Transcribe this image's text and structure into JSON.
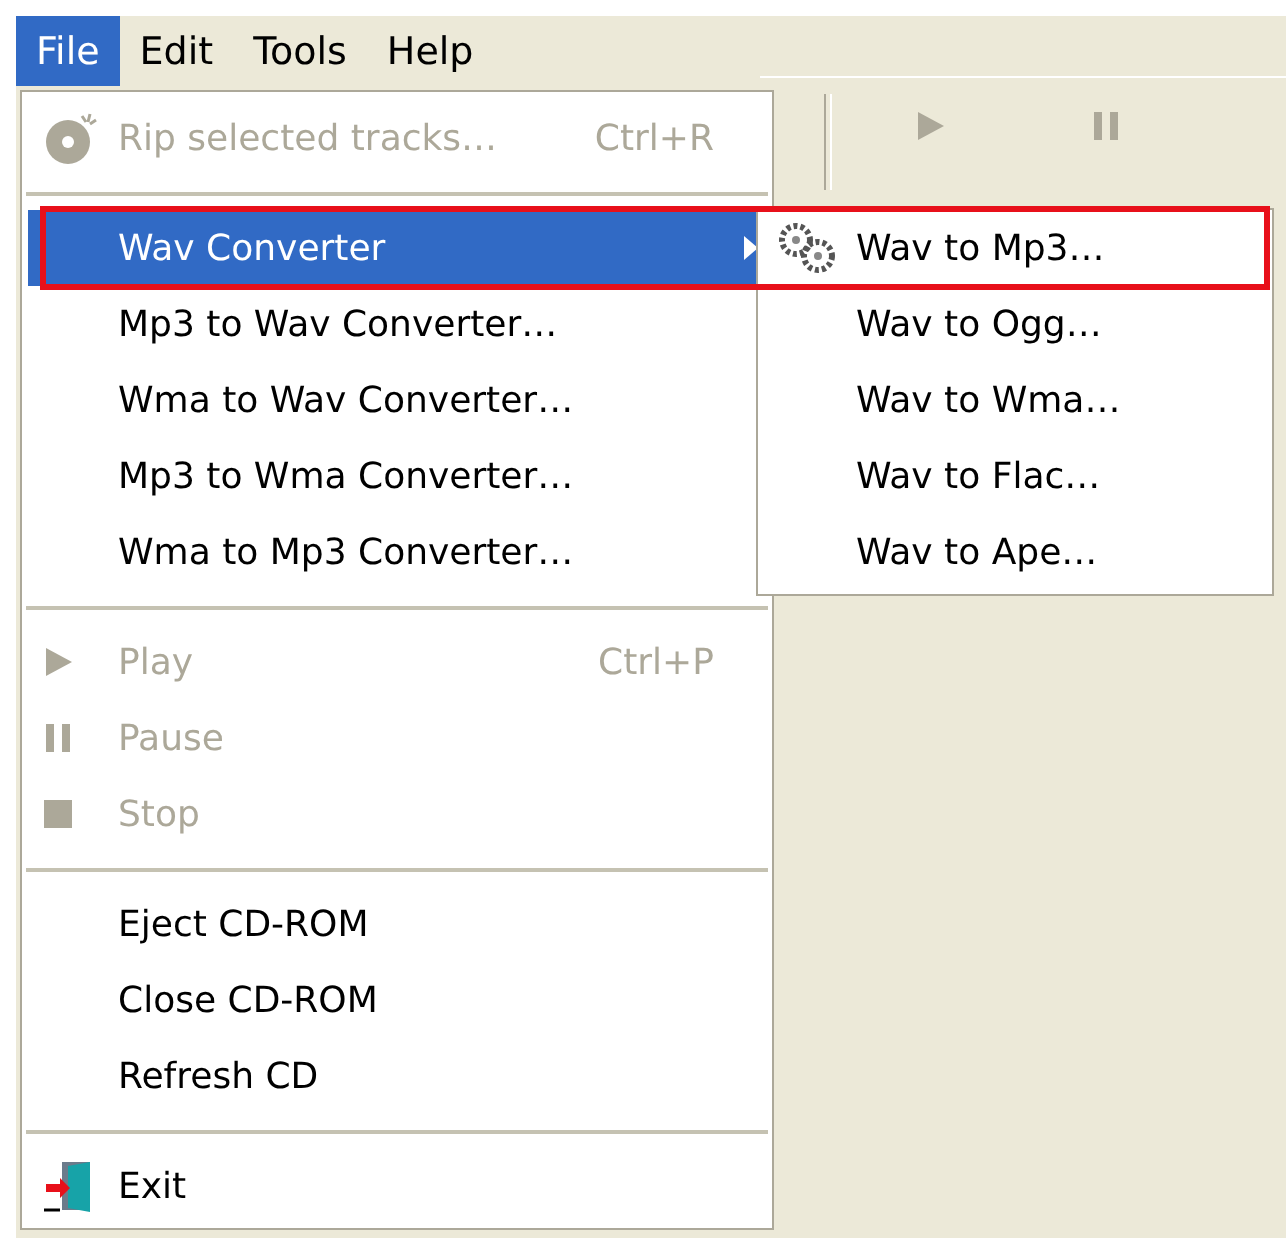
{
  "menubar": [
    {
      "label": "File",
      "selected": true
    },
    {
      "label": "Edit",
      "selected": false
    },
    {
      "label": "Tools",
      "selected": false
    },
    {
      "label": "Help",
      "selected": false
    }
  ],
  "file_menu": [
    {
      "kind": "item",
      "label": "Rip selected tracks…",
      "shortcut": "Ctrl+R",
      "disabled": true,
      "selected": false
    },
    {
      "kind": "separator"
    },
    {
      "kind": "submenu",
      "label": "Wav Converter",
      "disabled": false,
      "selected": true
    },
    {
      "kind": "item",
      "label": "Mp3 to Wav Converter…",
      "disabled": false,
      "selected": false
    },
    {
      "kind": "item",
      "label": "Wma to Wav Converter…",
      "disabled": false,
      "selected": false
    },
    {
      "kind": "item",
      "label": "Mp3 to Wma Converter…",
      "disabled": false,
      "selected": false
    },
    {
      "kind": "item",
      "label": "Wma to Mp3 Converter…",
      "disabled": false,
      "selected": false
    },
    {
      "kind": "separator"
    },
    {
      "kind": "item",
      "label": "Play",
      "shortcut": "Ctrl+P",
      "disabled": true,
      "selected": false
    },
    {
      "kind": "item",
      "label": "Pause",
      "disabled": true,
      "selected": false
    },
    {
      "kind": "item",
      "label": "Stop",
      "disabled": true,
      "selected": false
    },
    {
      "kind": "separator"
    },
    {
      "kind": "item",
      "label": "Eject CD-ROM",
      "disabled": false,
      "selected": false
    },
    {
      "kind": "item",
      "label": "Close CD-ROM",
      "disabled": false,
      "selected": false
    },
    {
      "kind": "item",
      "label": "Refresh CD",
      "disabled": false,
      "selected": false
    },
    {
      "kind": "separator"
    },
    {
      "kind": "item",
      "label": "Exit",
      "disabled": false,
      "selected": false
    }
  ],
  "submenu": [
    {
      "label": "Wav to Mp3…"
    },
    {
      "label": "Wav to Ogg…"
    },
    {
      "label": "Wav to Wma…"
    },
    {
      "label": "Wav to Flac…"
    },
    {
      "label": "Wav to Ape…"
    }
  ]
}
